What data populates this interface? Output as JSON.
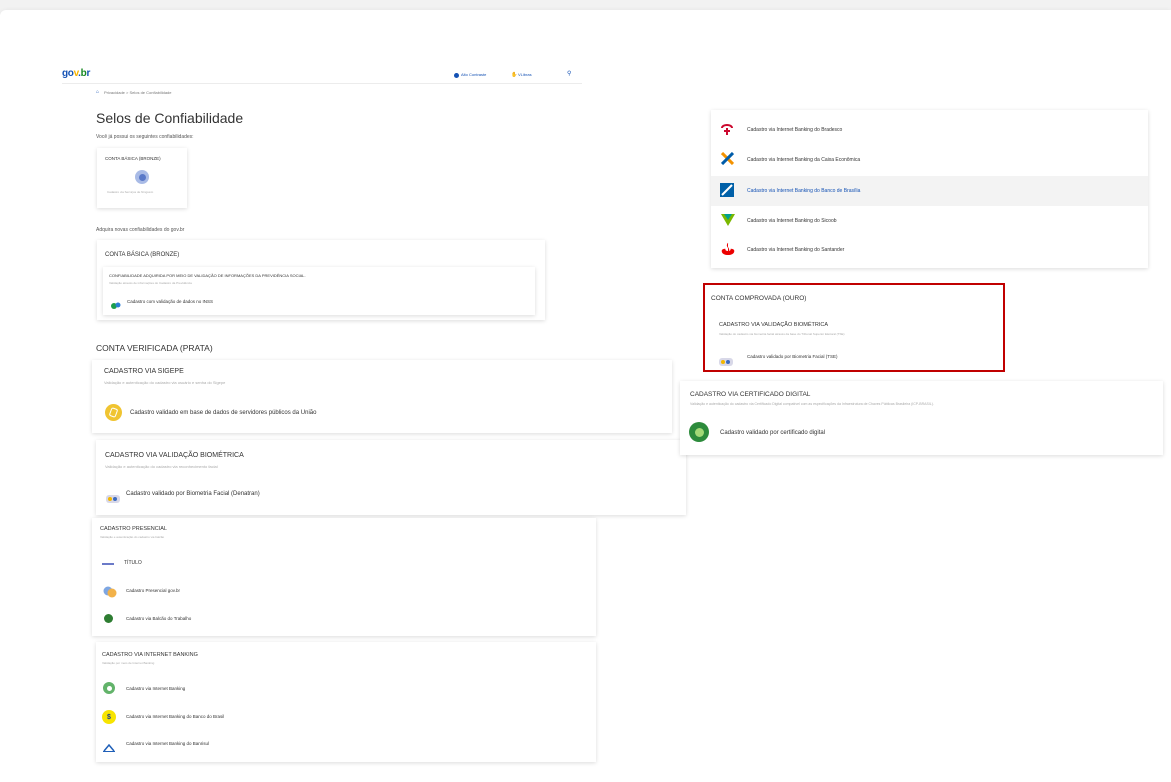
{
  "header": {
    "logo_text": "gov.br",
    "nav1": "Alto Contraste",
    "nav2": "VLibras",
    "breadcrumb": "Privacidade  >  Selos de Confiabilidade"
  },
  "page": {
    "title": "Selos de Confiabilidade",
    "subtitle": "Você já possui os seguintes confiabilidades:",
    "acquire_text": "Adquira novas confiabilidades do gov.br"
  },
  "current": {
    "title": "CONTA BÁSICA (BRONZE)",
    "desc": "Cadastro via Serviços de Ninguém"
  },
  "bronze": {
    "title": "CONTA BÁSICA (BRONZE)",
    "subtitle": "CONFIABILIDADE ADQUIRIDA POR MEIO DE VALIDAÇÃO DE INFORMAÇÕES DA PREVIDÊNCIA SOCIAL.",
    "desc": "Validação através de informações do Cadastro da Previdência",
    "item": "Cadastro com validação de dados no INSS"
  },
  "prata": {
    "title": "CONTA VERIFICADA (PRATA)",
    "sigepe_title": "CADASTRO VIA SIGEPE",
    "sigepe_desc": "Validação e autenticação do cadastro via usuário e senha do Sigepe",
    "sigepe_item": "Cadastro validado em base de dados de servidores públicos da União",
    "bio_title": "CADASTRO VIA VALIDAÇÃO BIOMÉTRICA",
    "bio_desc": "Validação e autenticação do cadastro via reconhecimento facial",
    "bio_item": "Cadastro validado por Biometria Facial (Denatran)"
  },
  "presencial": {
    "title": "CADASTRO PRESENCIAL",
    "desc": "Validação e autenticação do cadastro via balcão",
    "sub": "TÍTULO",
    "item1": "Cadastro Presencial gov.br",
    "item2": "Cadastro via Balcão do Trabalho"
  },
  "ib": {
    "title": "CADASTRO VIA INTERNET BANKING",
    "desc": "Validação por meio de Internet Banking",
    "item1": "Cadastro via Internet Banking",
    "item2": "Cadastro via Internet Banking do Banco do Brasil",
    "item3": "Cadastro via Internet Banking do Banrisul"
  },
  "banks": {
    "item1": "Cadastro via Internet Banking do Bradesco",
    "item2": "Cadastro via Internet Banking da Caixa Econômica",
    "item3": "Cadastro via Internet Banking do Banco de Brasília",
    "item4": "Cadastro via Internet Banking do Sicoob",
    "item5": "Cadastro via Internet Banking do Santander"
  },
  "ouro": {
    "title": "CONTA COMPROVADA (OURO)",
    "sub": "CADASTRO VIA VALIDAÇÃO BIOMÉTRICA",
    "desc": "Validação do cadastro via biometria facial através da base do Tribunal Superior Eleitoral (TSE)",
    "item": "Cadastro validado por Biometria Facial (TSE)"
  },
  "cert": {
    "title": "CADASTRO VIA CERTIFICADO DIGITAL",
    "desc": "Validação e autenticação do cadastro via Certificado Digital compatível com as especificações da Infraestrutura de Chaves Públicas Brasileira (ICP-BRASIL).",
    "item": "Cadastro validado por certificado digital"
  },
  "colors": {
    "govbr_blue": "#1351b4",
    "highlight_border": "#c00000",
    "hover_row": "#f3f3f3"
  }
}
